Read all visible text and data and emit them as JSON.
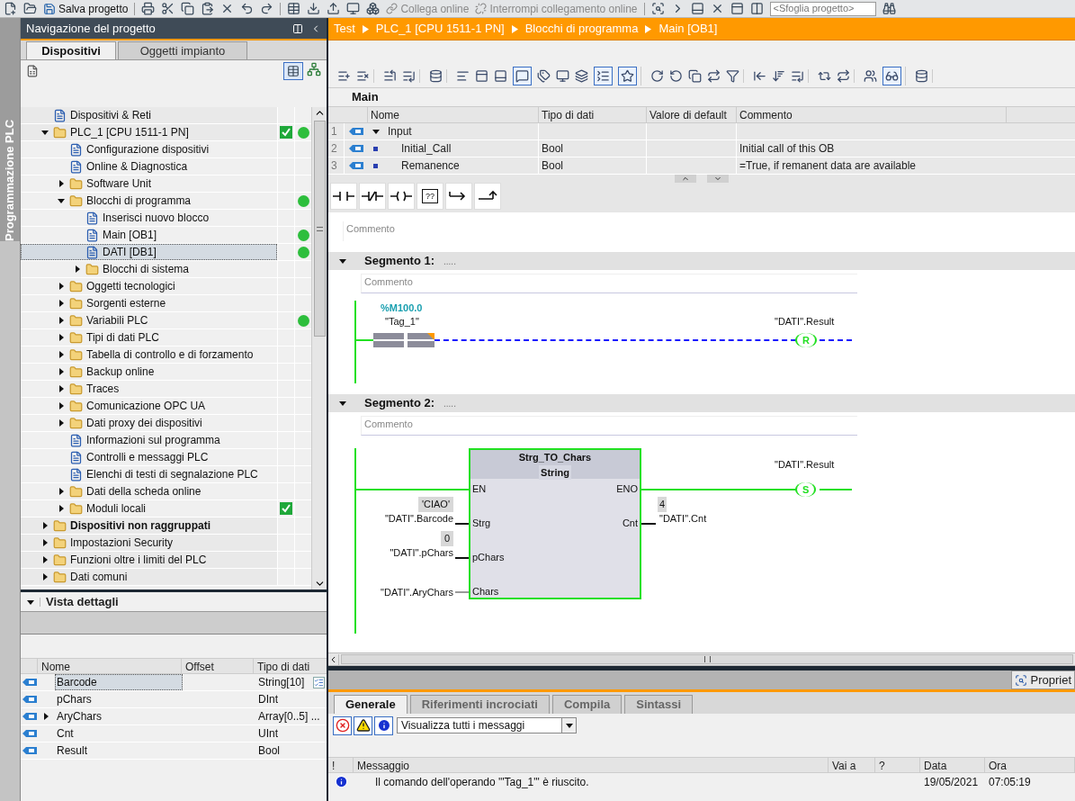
{
  "toolbar": {
    "save_label": "Salva progetto",
    "connect_online": {
      "label": "Collega online",
      "disabled": true
    },
    "disconnect_online": {
      "label": "Interrompi collegamento online",
      "disabled": true
    },
    "search": {
      "placeholder": "<Sfoglia progetto>"
    }
  },
  "side_strip": {
    "label": "Programmazione PLC"
  },
  "project_navigation": {
    "title": "Navigazione del progetto",
    "tabs": [
      {
        "label": "Dispositivi",
        "selected": true
      },
      {
        "label": "Oggetti impianto",
        "selected": false
      }
    ],
    "view_toggle": {
      "pressed": true
    },
    "tree": [
      {
        "label": "Dispositivi & Reti",
        "kind": "leaf",
        "selected": false,
        "emphasized": false,
        "consistent": false,
        "online_ok": false
      },
      {
        "label": "PLC_1 [CPU 1511-1 PN]",
        "kind": "group",
        "expanded": true,
        "selected": false,
        "emphasized": false,
        "consistent": true,
        "online_ok": true,
        "children": [
          {
            "label": "Configurazione dispositivi",
            "kind": "leaf",
            "selected": false,
            "emphasized": false,
            "consistent": false,
            "online_ok": false
          },
          {
            "label": "Online & Diagnostica",
            "kind": "leaf",
            "selected": false,
            "emphasized": false,
            "consistent": false,
            "online_ok": false
          },
          {
            "label": "Software Unit",
            "kind": "group",
            "expanded": false,
            "selected": false,
            "emphasized": false,
            "consistent": false,
            "online_ok": false
          },
          {
            "label": "Blocchi di programma",
            "kind": "group",
            "expanded": true,
            "selected": false,
            "emphasized": false,
            "consistent": false,
            "online_ok": true,
            "children": [
              {
                "label": "Inserisci nuovo blocco",
                "kind": "leaf",
                "selected": false,
                "emphasized": false,
                "consistent": false,
                "online_ok": false
              },
              {
                "label": "Main [OB1]",
                "kind": "leaf",
                "selected": false,
                "emphasized": false,
                "consistent": false,
                "online_ok": true
              },
              {
                "label": "DATI [DB1]",
                "kind": "leaf",
                "selected": true,
                "emphasized": false,
                "consistent": false,
                "online_ok": true
              },
              {
                "label": "Blocchi di sistema",
                "kind": "group",
                "expanded": false,
                "selected": false,
                "emphasized": false,
                "consistent": false,
                "online_ok": false
              }
            ]
          },
          {
            "label": "Oggetti tecnologici",
            "kind": "group",
            "expanded": false,
            "selected": false,
            "emphasized": false,
            "consistent": false,
            "online_ok": false
          },
          {
            "label": "Sorgenti esterne",
            "kind": "group",
            "expanded": false,
            "selected": false,
            "emphasized": false,
            "consistent": false,
            "online_ok": false
          },
          {
            "label": "Variabili PLC",
            "kind": "group",
            "expanded": false,
            "selected": false,
            "emphasized": false,
            "consistent": false,
            "online_ok": true
          },
          {
            "label": "Tipi di dati PLC",
            "kind": "group",
            "expanded": false,
            "selected": false,
            "emphasized": false,
            "consistent": false,
            "online_ok": false
          },
          {
            "label": "Tabella di controllo e di forzamento",
            "kind": "group",
            "expanded": false,
            "selected": false,
            "emphasized": false,
            "consistent": false,
            "online_ok": false
          },
          {
            "label": "Backup online",
            "kind": "group",
            "expanded": false,
            "selected": false,
            "emphasized": false,
            "consistent": false,
            "online_ok": false
          },
          {
            "label": "Traces",
            "kind": "group",
            "expanded": false,
            "selected": false,
            "emphasized": false,
            "consistent": false,
            "online_ok": false
          },
          {
            "label": "Comunicazione OPC UA",
            "kind": "group",
            "expanded": false,
            "selected": false,
            "emphasized": false,
            "consistent": false,
            "online_ok": false
          },
          {
            "label": "Dati proxy dei dispositivi",
            "kind": "group",
            "expanded": false,
            "selected": false,
            "emphasized": false,
            "consistent": false,
            "online_ok": false
          },
          {
            "label": "Informazioni sul programma",
            "kind": "leaf",
            "selected": false,
            "emphasized": false,
            "consistent": false,
            "online_ok": false
          },
          {
            "label": "Controlli e messaggi PLC",
            "kind": "leaf",
            "selected": false,
            "emphasized": false,
            "consistent": false,
            "online_ok": false
          },
          {
            "label": "Elenchi di testi di segnalazione PLC",
            "kind": "leaf",
            "selected": false,
            "emphasized": false,
            "consistent": false,
            "online_ok": false
          },
          {
            "label": "Dati della scheda online",
            "kind": "group",
            "expanded": false,
            "selected": false,
            "emphasized": false,
            "consistent": false,
            "online_ok": false
          },
          {
            "label": "Moduli locali",
            "kind": "group",
            "expanded": false,
            "selected": false,
            "emphasized": false,
            "consistent": true,
            "online_ok": false
          }
        ]
      },
      {
        "label": "Dispositivi non raggruppati",
        "kind": "group",
        "expanded": false,
        "selected": false,
        "emphasized": true,
        "consistent": false,
        "online_ok": false
      },
      {
        "label": "Impostazioni Security",
        "kind": "group",
        "expanded": false,
        "selected": false,
        "emphasized": false,
        "consistent": false,
        "online_ok": false
      },
      {
        "label": "Funzioni oltre i limiti del PLC",
        "kind": "group",
        "expanded": false,
        "selected": false,
        "emphasized": false,
        "consistent": false,
        "online_ok": false
      },
      {
        "label": "Dati comuni",
        "kind": "group",
        "expanded": false,
        "selected": false,
        "emphasized": false,
        "consistent": false,
        "online_ok": false
      }
    ]
  },
  "details_view": {
    "title": "Vista dettagli",
    "expanded": true,
    "columns": [
      "Nome",
      "Offset",
      "Tipo di dati"
    ],
    "rows": [
      {
        "name": "Barcode",
        "type": "String[10]",
        "kind": "scalar",
        "selected": true
      },
      {
        "name": "pChars",
        "type": "DInt",
        "kind": "scalar",
        "selected": false
      },
      {
        "name": "AryChars",
        "type": "Array[0..5] ...",
        "kind": "array",
        "selected": false
      },
      {
        "name": "Cnt",
        "type": "UInt",
        "kind": "scalar",
        "selected": false
      },
      {
        "name": "Result",
        "type": "Bool",
        "kind": "scalar",
        "selected": false
      }
    ]
  },
  "breadcrumb": [
    "Test",
    "PLC_1 [CPU 1511-1 PN]",
    "Blocchi di programma",
    "Main [OB1]"
  ],
  "editor_toolbar": {
    "toggles": [
      {
        "pressed": true
      },
      {
        "pressed": true
      },
      {
        "pressed": true
      },
      {
        "pressed": true
      }
    ]
  },
  "interface": {
    "title": "Main",
    "columns": [
      "Nome",
      "Tipo di dati",
      "Valore di default",
      "Commento"
    ],
    "rows": [
      {
        "number": "1",
        "name": "Input",
        "kind": "section",
        "expanded": true
      },
      {
        "number": "2",
        "name": "Initial_Call",
        "type": "Bool",
        "comment": "Initial call of this OB",
        "kind": "parameter"
      },
      {
        "number": "3",
        "name": "Remanence",
        "type": "Bool",
        "comment": "=True, if remanent data are available",
        "kind": "parameter"
      }
    ]
  },
  "palette": {
    "box_label": "??"
  },
  "block_comment": {
    "placeholder": "Commento"
  },
  "segments": [
    {
      "title": "Segmento 1:",
      "dots": ".....",
      "expanded": true,
      "comment_placeholder": "Commento",
      "kind": "contact_coil",
      "powered": false,
      "contact": {
        "address": "%M100.0",
        "tag": "\"Tag_1\""
      },
      "coil": {
        "operand": "\"DATI\".Result",
        "letter": "R"
      }
    },
    {
      "title": "Segmento 2:",
      "dots": ".....",
      "expanded": true,
      "comment_placeholder": "Commento",
      "kind": "box_coil",
      "powered": true,
      "box": {
        "name": "Strg_TO_Chars",
        "type": "String",
        "en": "EN",
        "eno": "ENO",
        "inputs": [
          {
            "pin": "Strg",
            "operand": "\"DATI\".Barcode",
            "value": "'CIAO'"
          },
          {
            "pin": "pChars",
            "operand": "\"DATI\".pChars",
            "value": "0"
          },
          {
            "pin": "Chars",
            "operand": "\"DATI\".AryChars"
          }
        ],
        "outputs": [
          {
            "pin": "Cnt",
            "operand": "\"DATI\".Cnt",
            "value": "4"
          }
        ]
      },
      "coil": {
        "operand": "\"DATI\".Result",
        "letter": "S"
      }
    }
  ],
  "inspector": {
    "properties_label": "Propriet",
    "tabs": [
      {
        "label": "Generale",
        "selected": true
      },
      {
        "label": "Riferimenti incrociati",
        "selected": false
      },
      {
        "label": "Compila",
        "selected": false
      },
      {
        "label": "Sintassi",
        "selected": false
      }
    ],
    "filters": [
      {
        "kind": "error",
        "pressed": true
      },
      {
        "kind": "warning",
        "pressed": true
      },
      {
        "kind": "info",
        "pressed": true
      }
    ],
    "filter_select": {
      "value": "Visualizza tutti i messaggi"
    },
    "columns": [
      "!",
      "Messaggio",
      "Vai a",
      "?",
      "Data",
      "Ora"
    ],
    "messages": [
      {
        "kind": "info",
        "message": "Il comando dell'operando '\"Tag_1\"' è riuscito.",
        "date": "19/05/2021",
        "time": "07:05:19"
      }
    ]
  }
}
